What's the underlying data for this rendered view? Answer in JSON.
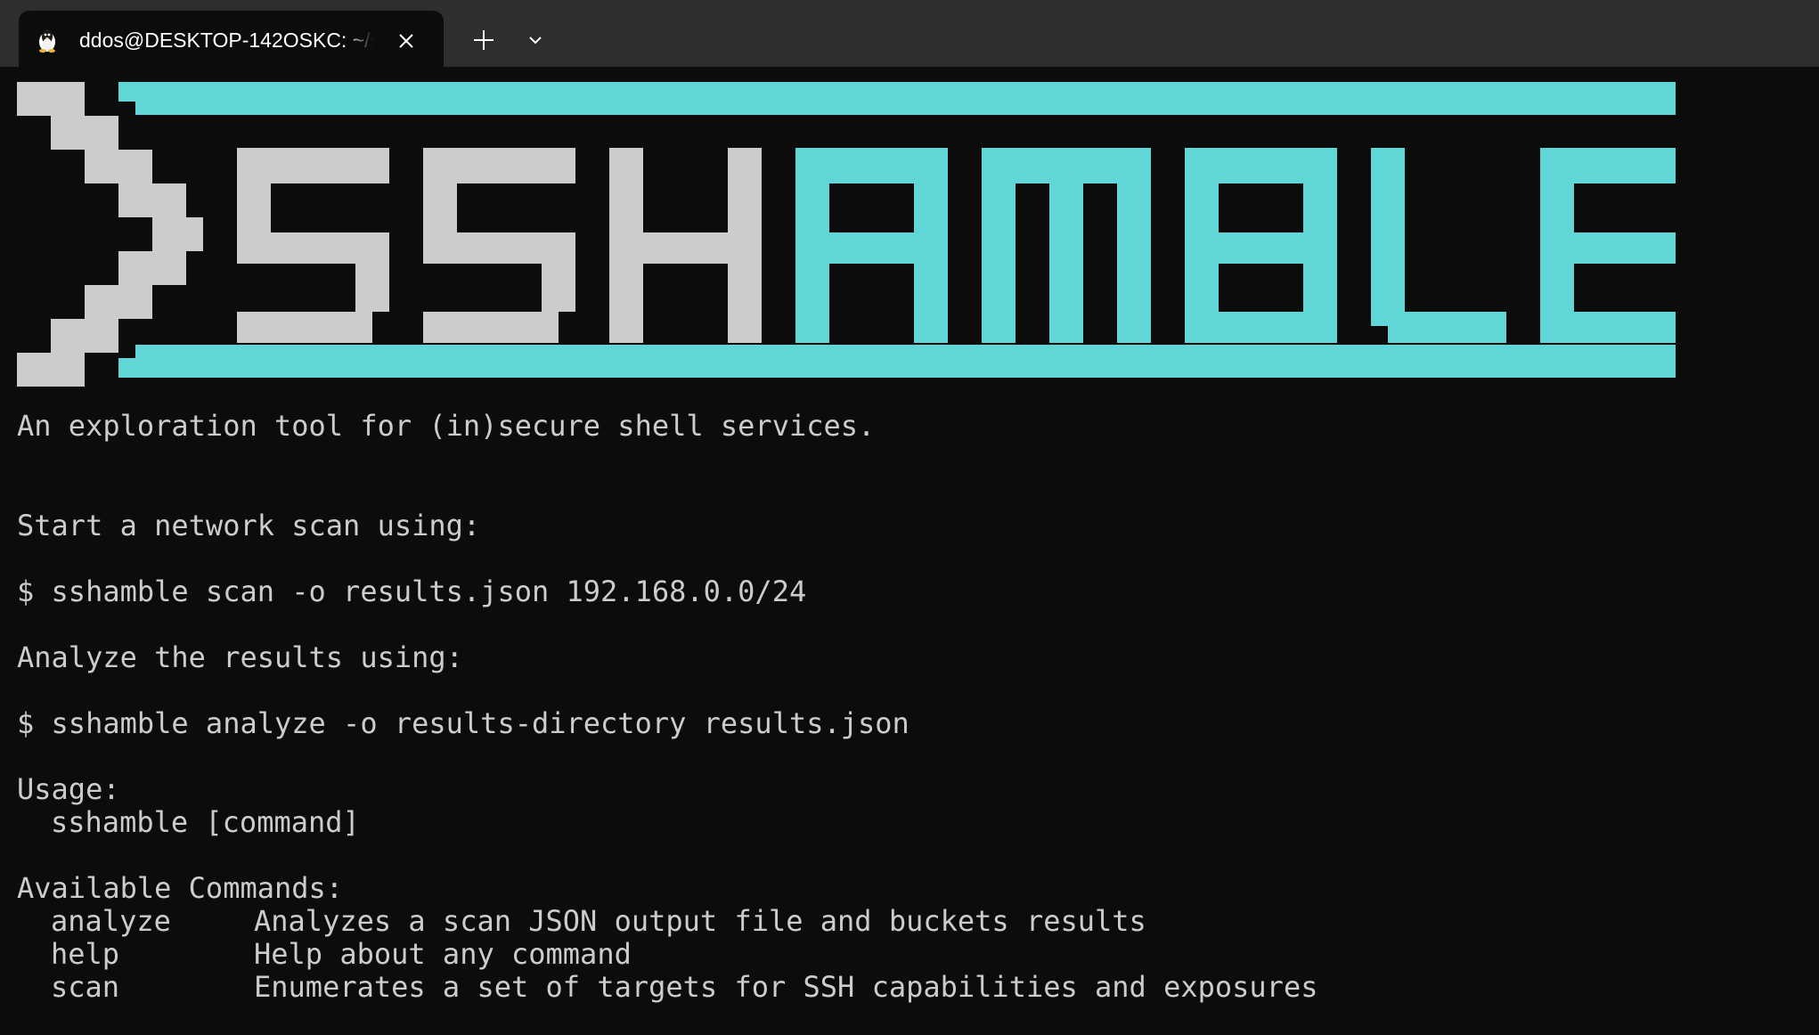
{
  "tab": {
    "icon": "linux-penguin-icon",
    "title": "ddos@DESKTOP-142OSKC: ~/s"
  },
  "colors": {
    "terminal_bg": "#0c0c0c",
    "terminal_fg": "#cccccc",
    "logo_gray": "#cccccc",
    "logo_cyan": "#61d6d6",
    "tabbar_bg": "#2e2e2e"
  },
  "logo": {
    "alt": ">SSHAMBLE"
  },
  "terminal": {
    "tagline": "An exploration tool for (in)secure shell services.",
    "scan_intro": "Start a network scan using:",
    "scan_command": "$ sshamble scan -o results.json 192.168.0.0/24",
    "analyze_intro": "Analyze the results using:",
    "analyze_command": "$ sshamble analyze -o results-directory results.json",
    "usage_header": "Usage:",
    "usage_value": "sshamble [command]",
    "commands_header": "Available Commands:",
    "commands": [
      {
        "name": "analyze",
        "description": "Analyzes a scan JSON output file and buckets results"
      },
      {
        "name": "help",
        "description": "Help about any command"
      },
      {
        "name": "scan",
        "description": "Enumerates a set of targets for SSH capabilities and exposures"
      }
    ]
  }
}
